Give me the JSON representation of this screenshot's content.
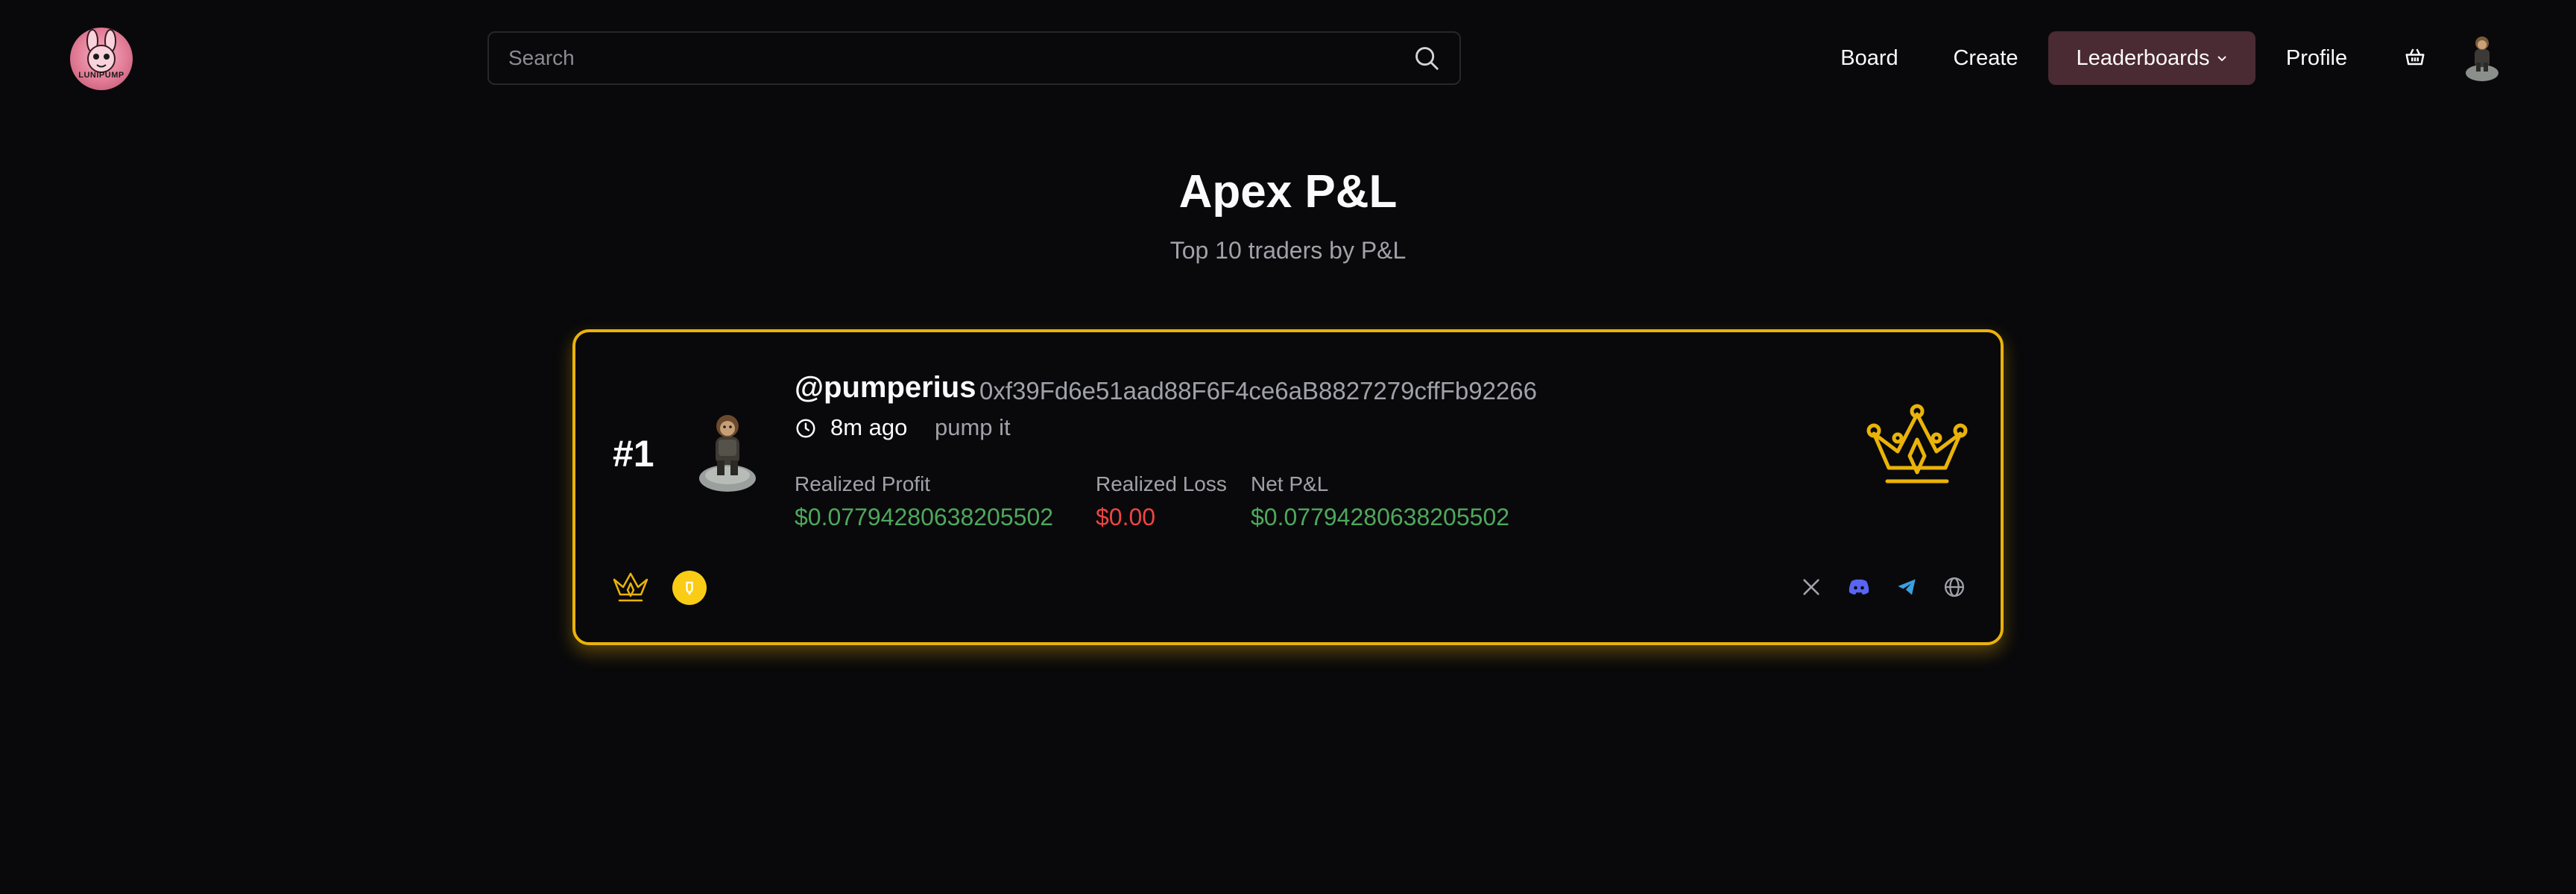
{
  "header": {
    "logo_text": "LUNIPUMP",
    "search_placeholder": "Search",
    "nav": {
      "board": "Board",
      "create": "Create",
      "leaderboards": "Leaderboards",
      "profile": "Profile"
    }
  },
  "page": {
    "title": "Apex P&L",
    "subtitle": "Top 10 traders by P&L"
  },
  "entry": {
    "rank": "#1",
    "username": "@pumperius",
    "address": "0xf39Fd6e51aad88F6F4ce6aB8827279cffFb92266",
    "time_ago": "8m ago",
    "bio": "pump it",
    "stats": {
      "profit_label": "Realized Profit",
      "profit_value": "$0.07794280638205502",
      "loss_label": "Realized Loss",
      "loss_value": "$0.00",
      "net_label": "Net P&L",
      "net_value": "$0.07794280638205502"
    }
  },
  "colors": {
    "accent_gold": "#eab308",
    "profit_green": "#4ea85c",
    "loss_red": "#ef4444",
    "active_nav": "#4a2a33",
    "discord": "#5865f2",
    "telegram": "#3b9fe0"
  },
  "icons": [
    "search-icon",
    "chevron-down-icon",
    "basket-icon",
    "clock-icon",
    "crown-icon",
    "coin-icon",
    "x-icon",
    "discord-icon",
    "telegram-icon",
    "globe-icon"
  ]
}
